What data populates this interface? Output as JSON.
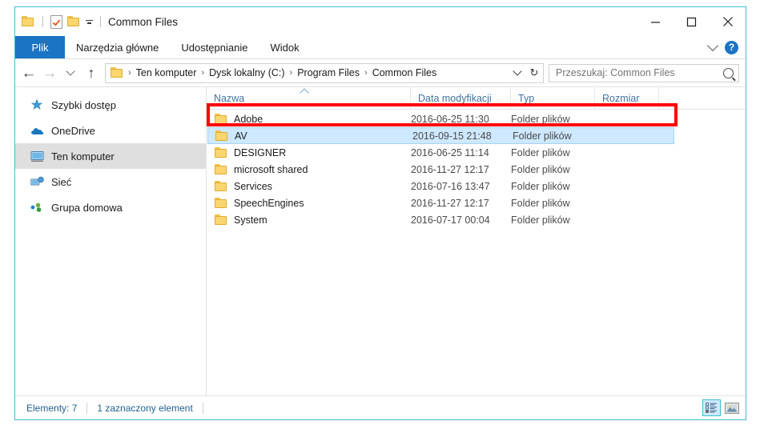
{
  "window": {
    "title": "Common Files",
    "quick_access": [
      {
        "name": "folder-icon",
        "label": "Folder"
      },
      {
        "name": "properties-icon",
        "label": "Właściwości"
      },
      {
        "name": "new-folder-icon",
        "label": "Nowy folder"
      },
      {
        "name": "customize-qat-icon",
        "label": "Dostosuj pasek narzędzi Szybki dostęp"
      }
    ],
    "controls": {
      "minimize": "Minimalizuj",
      "maximize": "Maksymalizuj",
      "close": "Zamknij"
    },
    "border_color": "#3bbfd0"
  },
  "ribbon": {
    "file_tab": "Plik",
    "tabs": [
      "Narzędzia główne",
      "Udostępnianie",
      "Widok"
    ],
    "expand_label": "Rozwiń Wstążkę",
    "help_label": "?",
    "file_tab_color": "#1b74c4"
  },
  "address": {
    "back_label": "←",
    "forward_label": "→",
    "recent_label": "Ostatnie lokalizacje",
    "up_label": "↑",
    "crumbs": [
      "Ten komputer",
      "Dysk lokalny (C:)",
      "Program Files",
      "Common Files"
    ],
    "separator": "›",
    "refresh_label": "↻",
    "dropdown_label": "Poprzednie lokalizacje"
  },
  "search": {
    "placeholder": "Przeszukaj: Common Files",
    "value": "",
    "icon": "search-icon"
  },
  "sidebar": {
    "items": [
      {
        "label": "Szybki dostęp",
        "icon": "pin-star-icon",
        "selected": false
      },
      {
        "label": "OneDrive",
        "icon": "cloud-icon",
        "selected": false
      },
      {
        "label": "Ten komputer",
        "icon": "computer-icon",
        "selected": true
      },
      {
        "label": "Sieć",
        "icon": "network-icon",
        "selected": false
      },
      {
        "label": "Grupa domowa",
        "icon": "homegroup-icon",
        "selected": false
      }
    ]
  },
  "filelist": {
    "columns": [
      "Nazwa",
      "Data modyfikacji",
      "Typ",
      "Rozmiar"
    ],
    "sort_column": "Nazwa",
    "sort_direction": "ascending",
    "rows": [
      {
        "name": "Adobe",
        "date": "2016-06-25 11:30",
        "type": "Folder plików",
        "size": "",
        "selected": false
      },
      {
        "name": "AV",
        "date": "2016-09-15 21:48",
        "type": "Folder plików",
        "size": "",
        "selected": true
      },
      {
        "name": "DESIGNER",
        "date": "2016-06-25 11:14",
        "type": "Folder plików",
        "size": "",
        "selected": false
      },
      {
        "name": "microsoft shared",
        "date": "2016-11-27 12:17",
        "type": "Folder plików",
        "size": "",
        "selected": false
      },
      {
        "name": "Services",
        "date": "2016-07-16 13:47",
        "type": "Folder plików",
        "size": "",
        "selected": false
      },
      {
        "name": "SpeechEngines",
        "date": "2016-11-27 12:17",
        "type": "Folder plików",
        "size": "",
        "selected": false
      },
      {
        "name": "System",
        "date": "2016-07-17 00:04",
        "type": "Folder plików",
        "size": "",
        "selected": false
      }
    ],
    "annotation_color": "#fe0000",
    "selection_color": "#cde8ff"
  },
  "status": {
    "item_count": "Elementy: 7",
    "selection": "1 zaznaczony element",
    "view_details_label": "Szczegóły",
    "view_large_icons_label": "Duże ikony"
  }
}
